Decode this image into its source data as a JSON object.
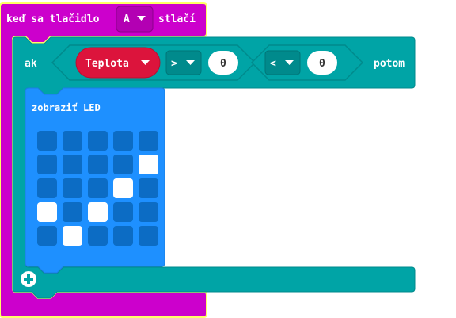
{
  "event_block": {
    "label_before": "keď sa tlačidlo",
    "button_value": "A",
    "label_after": "stlačí",
    "color": "#cc00cc",
    "outline": "#ffff66"
  },
  "if_block": {
    "label_if": "ak",
    "label_then": "potom",
    "color": "#00a4a6",
    "operators_color": "#008a8c",
    "reporter": {
      "label": "Teplota",
      "color": "#dc143c"
    },
    "compare_gt": {
      "operator": ">",
      "value": "0"
    },
    "compare_lt": {
      "operator": "<",
      "value": "0"
    },
    "add_icon": "plus-circle-icon"
  },
  "show_leds": {
    "label": "zobraziť LED",
    "color": "#1e90ff",
    "led_off_color": "#0c6cc4",
    "led_on_color": "#ffffff",
    "grid": [
      [
        0,
        0,
        0,
        0,
        0
      ],
      [
        0,
        0,
        0,
        0,
        1
      ],
      [
        0,
        0,
        0,
        1,
        0
      ],
      [
        1,
        0,
        1,
        0,
        0
      ],
      [
        0,
        1,
        0,
        0,
        0
      ]
    ]
  }
}
